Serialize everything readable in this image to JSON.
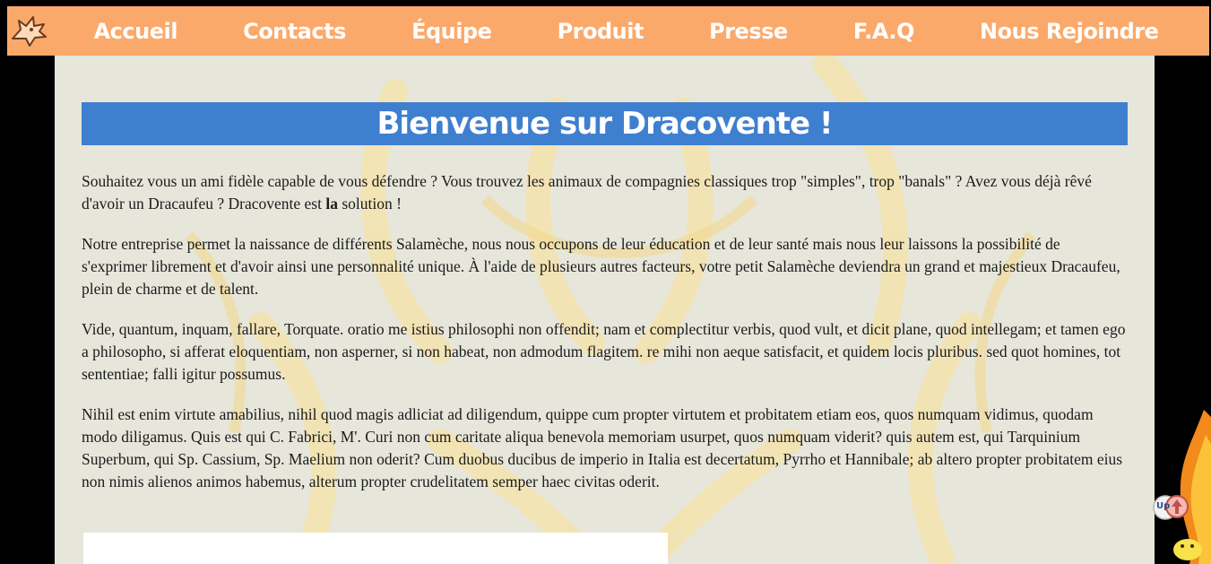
{
  "nav": {
    "logo_icon": "dragon-head-icon",
    "items": [
      {
        "label": "Accueil"
      },
      {
        "label": "Contacts"
      },
      {
        "label": "Équipe"
      },
      {
        "label": "Produit"
      },
      {
        "label": "Presse"
      },
      {
        "label": "F.A.Q"
      },
      {
        "label": "Nous Rejoindre"
      }
    ]
  },
  "main": {
    "title": "Bienvenue sur Dracovente !",
    "intro_before": "Souhaitez vous un ami fidèle capable de vous défendre ? Vous trouvez les animaux de compagnies classiques trop \"simples\", trop \"banals\" ? Avez vous déjà rêvé d'avoir un Dracaufeu ? Dracovente est ",
    "intro_bold": "la",
    "intro_after": " solution !",
    "paragraphs": [
      "Notre entreprise permet la naissance de différents Salamèche, nous nous occupons de leur éducation et de leur santé mais nous leur laissons la possibilité de s'exprimer librement et d'avoir ainsi une personnalité unique. À l'aide de plusieurs autres facteurs, votre petit Salamèche deviendra un grand et majestieux Dracaufeu, plein de charme et de talent.",
      "Vide, quantum, inquam, fallare, Torquate. oratio me istius philosophi non offendit; nam et complectitur verbis, quod vult, et dicit plane, quod intellegam; et tamen ego a philosopho, si afferat eloquentiam, non asperner, si non habeat, non admodum flagitem. re mihi non aeque satisfacit, et quidem locis pluribus. sed quot homines, tot sententiae; falli igitur possumus.",
      "Nihil est enim virtute amabilius, nihil quod magis adliciat ad diligendum, quippe cum propter virtutem et probitatem etiam eos, quos numquam vidimus, quodam modo diligamus. Quis est qui C. Fabrici, M'. Curi non cum caritate aliqua benevola memoriam usurpet, quos numquam viderit? quis autem est, qui Tarquinium Superbum, qui Sp. Cassium, Sp. Maelium non oderit? Cum duobus ducibus de imperio in Italia est decertatum, Pyrrho et Hannibale; ab altero propter probitatem eius non nimis alienos animos habemus, alterum propter crudelitatem semper haec civitas oderit."
    ]
  },
  "scroll_up": {
    "label": "Up",
    "icon": "arrow-up-icon"
  },
  "colors": {
    "nav_bg": "#fba96a",
    "title_bg": "#3e7fd0",
    "content_bg": "#e7e6db",
    "page_bg": "#000000"
  }
}
